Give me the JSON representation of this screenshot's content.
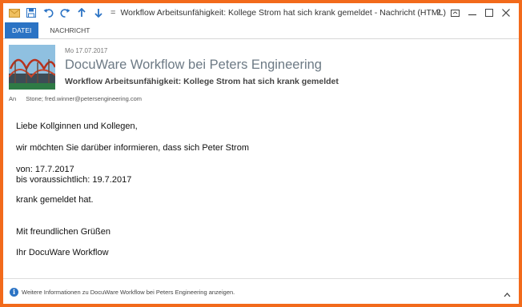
{
  "window": {
    "title": "Workflow Arbeitsunfähigkeit: Kollege Strom hat sich krank gemeldet - Nachricht (HTML)",
    "controls": {
      "help": "?",
      "ribbon_display": "",
      "minimize": "",
      "maximize": "",
      "close": ""
    }
  },
  "quick_access": {
    "icons": [
      "mail-icon",
      "save-icon",
      "undo-icon",
      "redo-icon",
      "previous-item-icon",
      "next-item-icon",
      "customize-toolbar-icon"
    ],
    "customize_glyph": "="
  },
  "ribbon": {
    "tabs": [
      {
        "label": "DATEI",
        "active": true
      },
      {
        "label": "NACHRICHT",
        "active": false
      }
    ]
  },
  "header": {
    "date": "Mo 17.07.2017",
    "sender": "DocuWare Workflow bei Peters Engineering",
    "subject": "Workflow Arbeitsunfähigkeit: Kollege Strom hat sich krank gemeldet",
    "to_label": "An",
    "to_value": "Stone; fred.winner@petersengineering.com"
  },
  "body": {
    "lines": [
      "Liebe Kollginnen und Kollegen,",
      "wir möchten Sie darüber informieren, dass sich Peter Strom",
      "von: 17.7.2017",
      "bis voraussichtlich: 19.7.2017",
      "krank gemeldet hat.",
      "Mit freundlichen Grüßen",
      "Ihr DocuWare Workflow"
    ]
  },
  "infobar": {
    "text": "Weitere Informationen zu DocuWare Workflow bei Peters Engineering anzeigen.",
    "icon": "info-icon",
    "icon_glyph": "i"
  },
  "colors": {
    "border": "#f26a1b",
    "accent": "#2b73c4",
    "sender_text": "#6d7a85"
  }
}
